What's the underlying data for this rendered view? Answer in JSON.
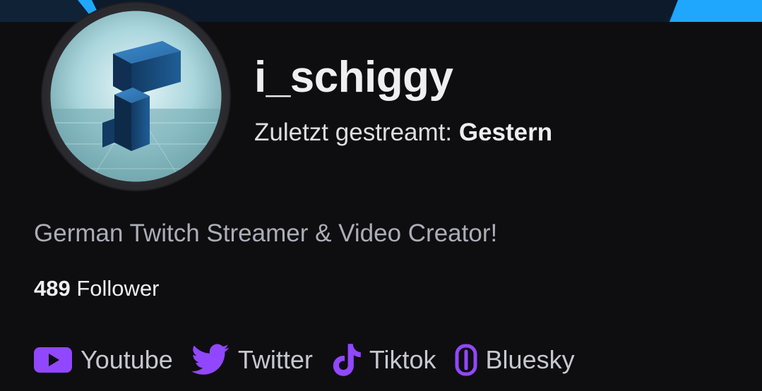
{
  "profile": {
    "username": "i_schiggy",
    "last_streamed_label": "Zuletzt gestreamt:",
    "last_streamed_value": "Gestern",
    "bio": "German Twitch Streamer & Video Creator!",
    "followers_count": "489",
    "followers_label": "Follower"
  },
  "socials": [
    {
      "label": "Youtube",
      "icon": "youtube-icon"
    },
    {
      "label": "Twitter",
      "icon": "twitter-icon"
    },
    {
      "label": "Tiktok",
      "icon": "tiktok-icon"
    },
    {
      "label": "Bluesky",
      "icon": "bluesky-icon"
    }
  ],
  "colors": {
    "background": "#0e0e10",
    "icon_accent": "#9147ff",
    "banner_accent": "#1ea7fd",
    "text_primary": "#efeff1",
    "text_secondary": "#adadb8"
  }
}
